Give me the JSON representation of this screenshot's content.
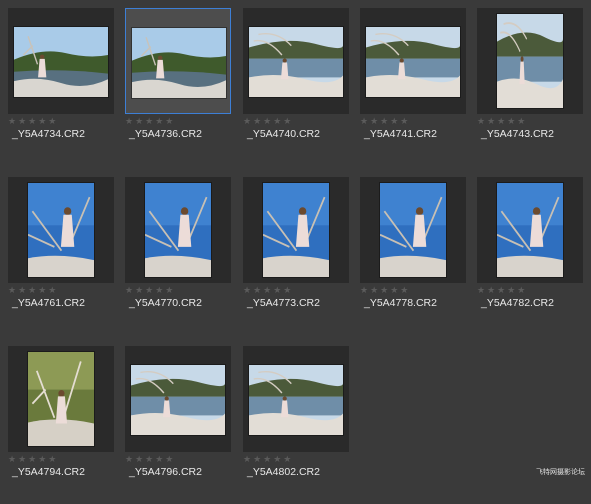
{
  "browser": {
    "star_glyphs": "★★★★★",
    "photos": [
      {
        "filename": "_Y5A4734.CR2",
        "orientation": "landscape",
        "scene": "rocks-sky",
        "selected": false
      },
      {
        "filename": "_Y5A4736.CR2",
        "orientation": "landscape",
        "scene": "rocks-sky",
        "selected": true
      },
      {
        "filename": "_Y5A4740.CR2",
        "orientation": "landscape",
        "scene": "lake",
        "selected": false
      },
      {
        "filename": "_Y5A4741.CR2",
        "orientation": "landscape",
        "scene": "lake",
        "selected": false
      },
      {
        "filename": "_Y5A4743.CR2",
        "orientation": "portrait",
        "scene": "lake",
        "selected": false
      },
      {
        "filename": "_Y5A4761.CR2",
        "orientation": "portrait",
        "scene": "sky-branches",
        "selected": false
      },
      {
        "filename": "_Y5A4770.CR2",
        "orientation": "portrait",
        "scene": "sky-branches",
        "selected": false
      },
      {
        "filename": "_Y5A4773.CR2",
        "orientation": "portrait",
        "scene": "sky-branches",
        "selected": false
      },
      {
        "filename": "_Y5A4778.CR2",
        "orientation": "portrait",
        "scene": "sky-branches",
        "selected": false
      },
      {
        "filename": "_Y5A4782.CR2",
        "orientation": "portrait",
        "scene": "sky-branches",
        "selected": false
      },
      {
        "filename": "_Y5A4794.CR2",
        "orientation": "portrait",
        "scene": "forest",
        "selected": false
      },
      {
        "filename": "_Y5A4796.CR2",
        "orientation": "landscape",
        "scene": "lake",
        "selected": false
      },
      {
        "filename": "_Y5A4802.CR2",
        "orientation": "landscape",
        "scene": "lake",
        "selected": false
      }
    ]
  },
  "watermark": "飞特网摄影论坛"
}
